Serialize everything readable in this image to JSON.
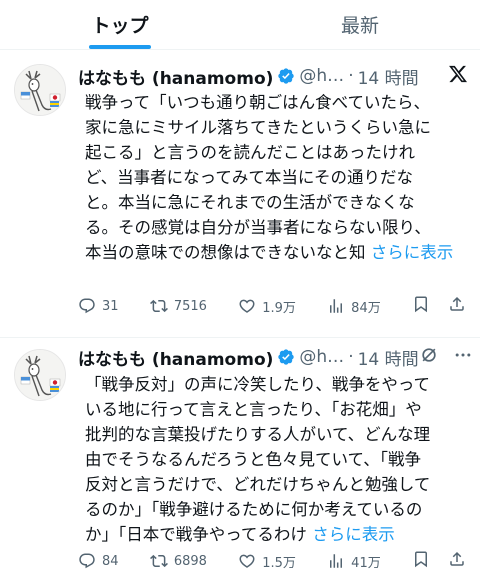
{
  "tabs": [
    {
      "label": "トップ",
      "active": true
    },
    {
      "label": "最新",
      "active": false
    }
  ],
  "tweets": [
    {
      "display_name": "はなもも (hanamomo)",
      "handle": "@h…",
      "time": "14 時間",
      "text": "戦争って「いつも通り朝ごはん食べていたら、\n家に急にミサイル落ちてきたというくらい急に\n起こる」と言うのを読んだことはあったけれ\nど、当事者になってみて本当にその通りだな\nと。本当に急にそれまでの生活ができなくな\nる。その感覚は自分が当事者にならない限り、\n本当の意味での想像はできないなと知",
      "more": "さらに表示",
      "replies": "31",
      "reposts": "7516",
      "likes": "1.9万",
      "views": "84万",
      "header_icon": "x-logo-icon"
    },
    {
      "display_name": "はなもも (hanamomo)",
      "handle": "@h…",
      "time": "14 時間",
      "text": "「戦争反対」の声に冷笑したり、戦争をやって\nいる地に行って言えと言ったり、「お花畑」や\n批判的な言葉投げたりする人がいて、どんな理\n由でそうなるんだろうと色々見ていて、「戦争\n反対と言うだけで、どれだけちゃんと勉強して\nるのか」「戦争避けるために何か考えているの\nか」「日本で戦争やってるわけ",
      "more": "さらに表示",
      "replies": "84",
      "reposts": "6898",
      "likes": "1.5万",
      "views": "41万",
      "header_icon": "grok-icon"
    }
  ],
  "colors": {
    "accent": "#1d9bf0",
    "text": "#0f1419",
    "secondary": "#536471",
    "divider": "#eff3f4"
  }
}
